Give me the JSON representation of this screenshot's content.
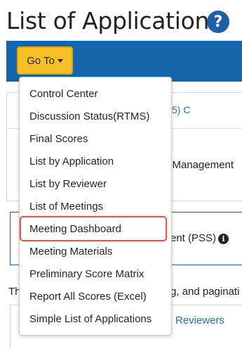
{
  "page": {
    "title": "List of Applications"
  },
  "toolbar": {
    "goto_label": "Go To"
  },
  "background": {
    "link_fragment": "5) C",
    "management_fragment": "l Management",
    "pss_fragment": "ent (PSS)",
    "instruction_start": "Th",
    "instruction_end": "g, and paginati",
    "reviewers_link": "Reviewers"
  },
  "menu": {
    "items": [
      {
        "label": "Control Center"
      },
      {
        "label": "Discussion Status(RTMS)"
      },
      {
        "label": "Final Scores"
      },
      {
        "label": "List by Application"
      },
      {
        "label": "List by Reviewer"
      },
      {
        "label": "List of Meetings"
      },
      {
        "label": "Meeting Dashboard",
        "highlighted": true
      },
      {
        "label": "Meeting Materials"
      },
      {
        "label": "Preliminary Score Matrix"
      },
      {
        "label": "Report All Scores (Excel)"
      },
      {
        "label": "Simple List of Applications"
      }
    ]
  },
  "colors": {
    "toolbar_bg": "#1565a8",
    "goto_button": "#f6c026",
    "highlight_border": "#e05a50",
    "link": "#1f6fb5"
  },
  "icons": {
    "help": "question-circle",
    "info": "info-circle",
    "caret": "caret-down"
  }
}
